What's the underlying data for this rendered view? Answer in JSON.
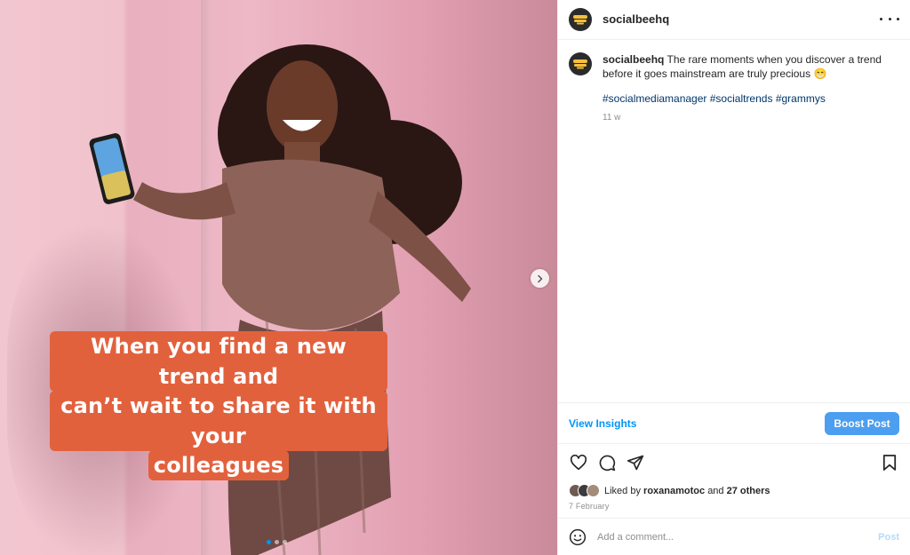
{
  "media": {
    "overlay_lines": [
      "When you find a new trend and",
      "can’t wait to share it with your",
      "colleagues"
    ],
    "carousel_count": 3,
    "active_index": 0
  },
  "header": {
    "username": "socialbeehq"
  },
  "caption": {
    "username": "socialbeehq",
    "text": "The rare moments when you discover a trend before it goes mainstream are truly precious 😁",
    "hashtags": [
      "#socialmediamanager",
      "#socialtrends",
      "#grammys"
    ],
    "age": "11 w"
  },
  "insights": {
    "view_label": "View Insights",
    "boost_label": "Boost Post"
  },
  "likes": {
    "prefix": "Liked by",
    "user": "roxanamotoc",
    "and": "and",
    "others": "27 others"
  },
  "date": "7 February",
  "comment": {
    "placeholder": "Add a comment...",
    "post_label": "Post"
  },
  "colors": {
    "accent": "#0095f6",
    "boost_bg": "#4c9ef0",
    "overlay_bg": "#e2613d"
  }
}
